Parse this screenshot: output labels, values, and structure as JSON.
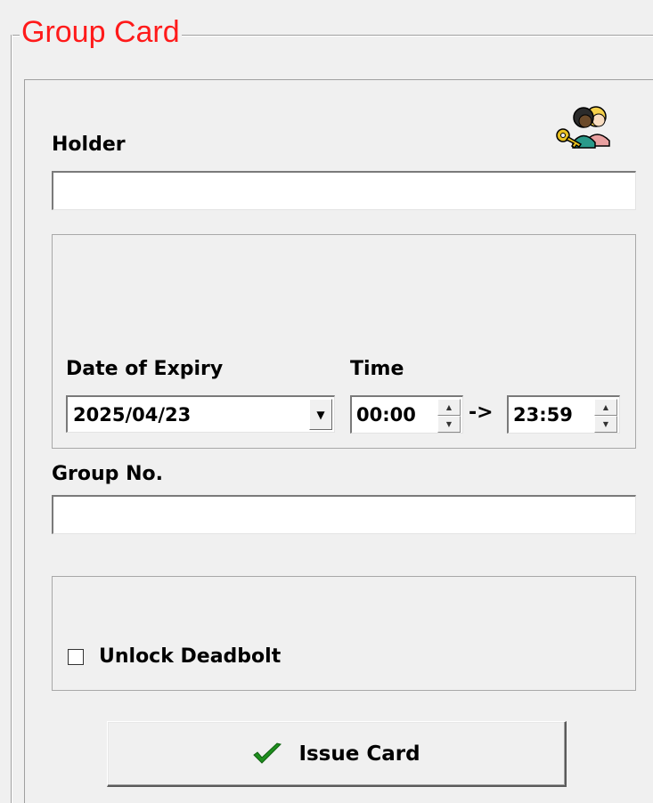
{
  "group": {
    "title": "Group Card",
    "title_color": "#ff1a1a"
  },
  "holder": {
    "label": "Holder",
    "value": "",
    "icon": "group-keys-icon"
  },
  "expiry": {
    "date_label": "Date of Expiry",
    "date_value": "2025/04/23",
    "time_label": "Time",
    "time_from": "00:00",
    "time_separator": "->",
    "time_to": "23:59"
  },
  "group_no": {
    "label": "Group No.",
    "value": ""
  },
  "options": {
    "unlock_deadbolt_label": "Unlock Deadbolt",
    "unlock_deadbolt_checked": false
  },
  "actions": {
    "issue_card_label": "Issue Card",
    "issue_icon": "checkmark-icon",
    "check_color": "#1f8f1f"
  }
}
